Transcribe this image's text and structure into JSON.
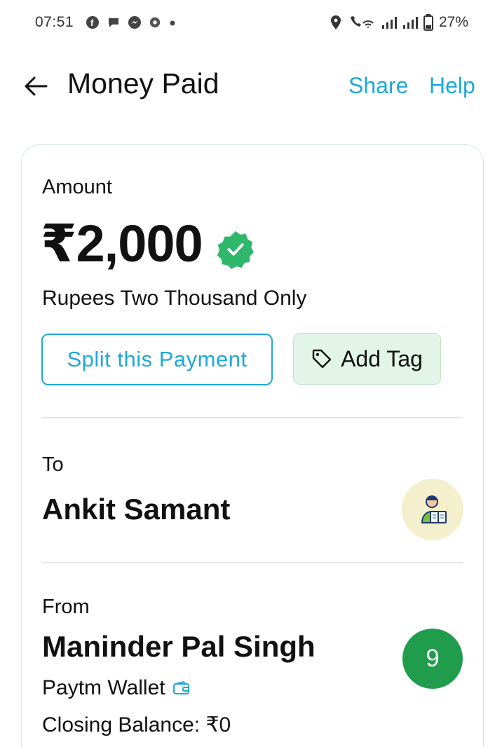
{
  "status_bar": {
    "time": "07:51",
    "battery_pct": "27%"
  },
  "header": {
    "title": "Money Paid",
    "share_label": "Share",
    "help_label": "Help"
  },
  "amount": {
    "label": "Amount",
    "value": "₹2,000",
    "in_words": "Rupees Two Thousand Only"
  },
  "actions": {
    "split_label": "Split this Payment",
    "tag_label": "Add Tag"
  },
  "to": {
    "label": "To",
    "name": "Ankit Samant"
  },
  "from": {
    "label": "From",
    "name": "Maninder Pal Singh",
    "avatar_initial": "9",
    "wallet": "Paytm Wallet",
    "closing_balance": "Closing Balance: ₹0"
  },
  "colors": {
    "accent": "#1ea9d8",
    "verified_green": "#2fb86c",
    "tag_bg": "#e3f4e8",
    "from_avatar_bg": "#1f9d4c",
    "to_avatar_bg": "#f4f0cd"
  },
  "icons": {
    "back": "arrow-left-icon",
    "verified": "verified-badge-icon",
    "tag": "tag-icon",
    "wallet": "wallet-icon",
    "person": "person-reading-icon"
  }
}
